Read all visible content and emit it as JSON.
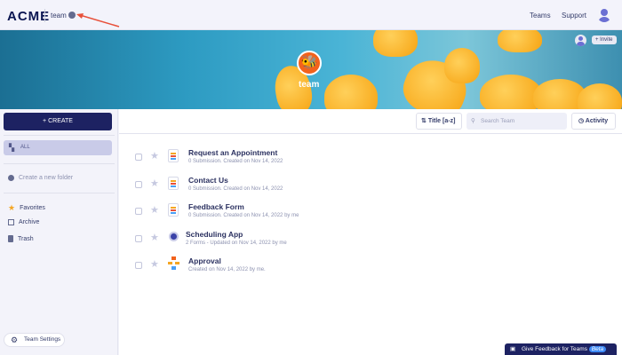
{
  "header": {
    "logo": "ACME",
    "team": "team",
    "nav": [
      "Teams",
      "Support"
    ]
  },
  "banner": {
    "team_name": "team",
    "invite": "+ Invite"
  },
  "sidebar": {
    "create": "+ CREATE",
    "all": "ALL",
    "new_folder": "Create a new folder",
    "items": [
      "Favorites",
      "Archive",
      "Trash"
    ],
    "settings": "Team Settings"
  },
  "toolbar": {
    "sort": "Title [a-z]",
    "search_placeholder": "Search Team",
    "activity": "Activity"
  },
  "rows": [
    {
      "title": "Request an Appointment",
      "sub": "0 Submission. Created on Nov 14, 2022",
      "type": "form"
    },
    {
      "title": "Contact Us",
      "sub": "0 Submission. Created on Nov 14, 2022",
      "type": "form"
    },
    {
      "title": "Feedback Form",
      "sub": "0 Submission. Created on Nov 14, 2022 by me",
      "type": "form"
    },
    {
      "title": "Scheduling App",
      "sub": "2 Forms - Updated on Nov 14, 2022 by me",
      "type": "app"
    },
    {
      "title": "Approval",
      "sub": "Created on Nov 14, 2022 by me.",
      "type": "approval"
    }
  ],
  "feedback": {
    "label": "Give Feedback for Teams",
    "beta": "Beta"
  }
}
